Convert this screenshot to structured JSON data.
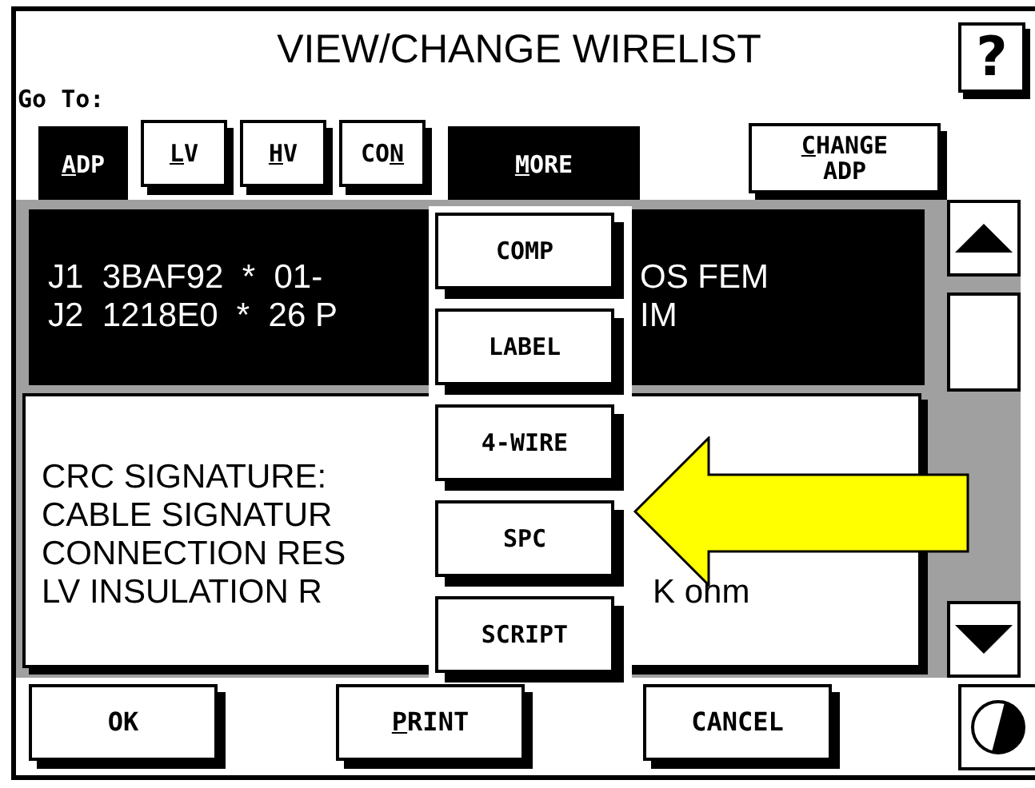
{
  "window": {
    "title": "VIEW/CHANGE WIRELIST",
    "help": "?"
  },
  "goto_label": "Go To:",
  "tabs": [
    {
      "key": "A",
      "after": "DP",
      "selected": true
    },
    {
      "key": "L",
      "after": "V",
      "selected": false
    },
    {
      "key": "H",
      "after": "V",
      "selected": false
    },
    {
      "before": "CO",
      "key": "N",
      "selected": false
    }
  ],
  "more_button": {
    "key": "M",
    "after": "ORE",
    "expanded": true
  },
  "change_button": {
    "line1_key": "C",
    "line1_rest": "HANGE",
    "line2": "ADP"
  },
  "connector_rows": [
    {
      "left": "J1  3BAF92  *  01-",
      "right": "OS FEM"
    },
    {
      "left": "J2  1218E0  *  26 P",
      "right": "IM"
    }
  ],
  "info_rows": [
    {
      "left": "CRC SIGNATURE:"
    },
    {
      "left": "CABLE SIGNATUR"
    },
    {
      "left": "CONNECTION RES"
    },
    {
      "left": "LV INSULATION R",
      "right": "K ohm"
    }
  ],
  "more_menu": [
    {
      "label": "COMP"
    },
    {
      "label": "LABEL"
    },
    {
      "label": "4-WIRE"
    },
    {
      "label": "SPC"
    },
    {
      "label": "SCRIPT"
    }
  ],
  "bottom_buttons": [
    {
      "after": "OK"
    },
    {
      "key": "P",
      "after": "RINT"
    },
    {
      "after": "CANCEL"
    }
  ]
}
